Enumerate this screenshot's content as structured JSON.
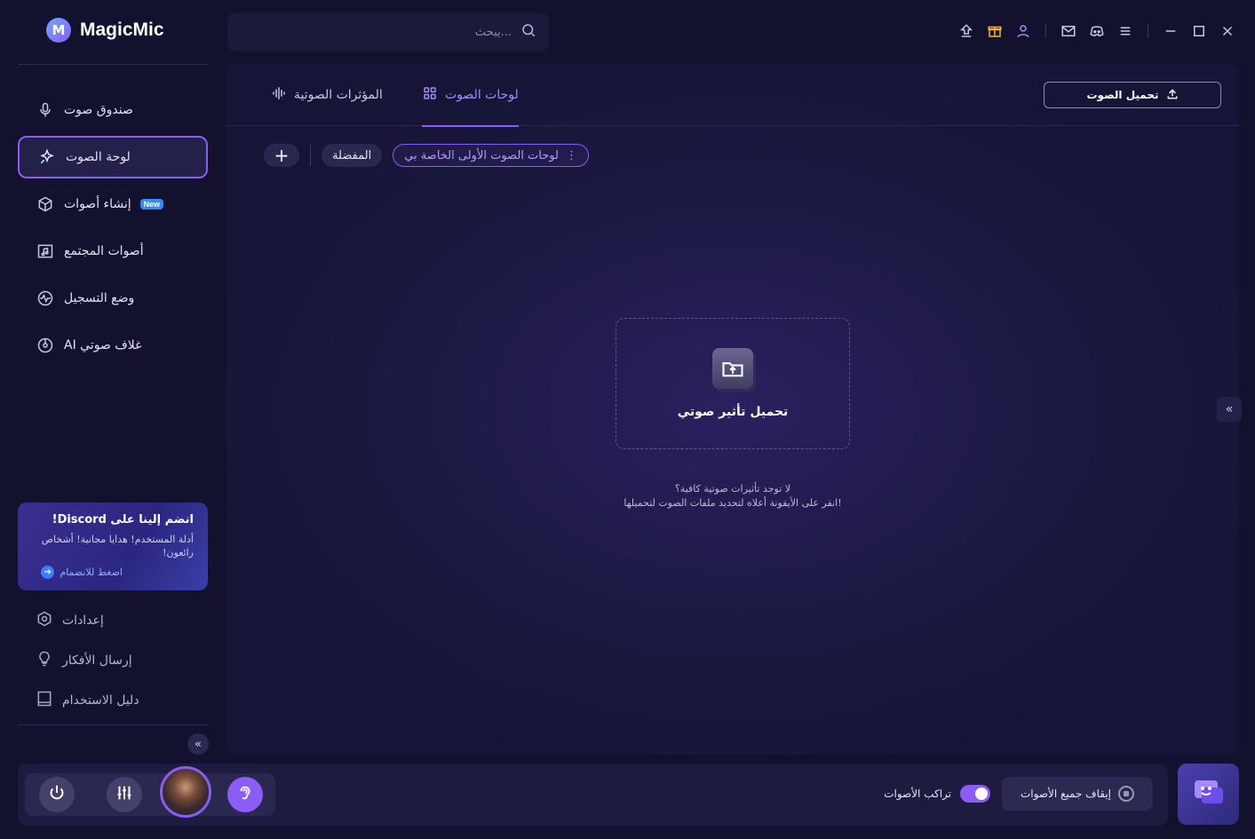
{
  "app": {
    "name": "MagicMic",
    "logo_letter": "M"
  },
  "search": {
    "placeholder": "...يبحث"
  },
  "sidebar": {
    "items": [
      {
        "label": "صندوق صوت",
        "icon": "microphone-icon",
        "active": false
      },
      {
        "label": "لوحة الصوت",
        "icon": "sparkle-board-icon",
        "active": true
      },
      {
        "label": "إنشاء أصوات",
        "icon": "cube-icon",
        "active": false,
        "badge": "New"
      },
      {
        "label": "أصوات المجتمع",
        "icon": "music-folder-icon",
        "active": false
      },
      {
        "label": "وضع التسجيل",
        "icon": "waveform-circle-icon",
        "active": false
      },
      {
        "label": "AI غلاف صوتي",
        "icon": "disc-icon",
        "active": false
      }
    ],
    "promo": {
      "title": "انضم إلينا على Discord!",
      "description": "أدلة المستخدم! هدايا مجانية! أشخاص رائعون!",
      "link": "اضغط للانضمام",
      "link_arrow": "➔"
    },
    "bottom_items": [
      {
        "label": "إعدادات",
        "icon": "settings-hexagon-icon"
      },
      {
        "label": "إرسال الأفكار",
        "icon": "lightbulb-icon"
      },
      {
        "label": "دليل الاستخدام",
        "icon": "book-icon"
      }
    ],
    "collapse_glyph": "«"
  },
  "main": {
    "tabs": [
      {
        "label": "لوحات الصوت",
        "icon": "grid-icon",
        "active": true
      },
      {
        "label": "المؤثرات الصوتية",
        "icon": "waveform-icon",
        "active": false
      }
    ],
    "upload_button": "تحميل الصوت",
    "chips": {
      "add": "+",
      "favorites": "المفضلة",
      "selected_board": "لوحات الصوت الأولى الخاصة بي",
      "menu_glyph": "⋮"
    },
    "dropzone_label": "تحميل تأثير صوتي",
    "hint_line1": "لا توجد تأثيرات صوتية كافية؟",
    "hint_line2": "انقر على الأيقونة أعلاه لتحديد ملفات الصوت لتحميلها!",
    "expand_glyph": "«"
  },
  "bottombar": {
    "overlap_label": "تراكب الأصوات",
    "overlap_enabled": true,
    "stop_all_label": "إيقاف جميع الأصوات"
  },
  "colors": {
    "accent": "#8b5cf6",
    "background": "#13122e",
    "panel": "#1d1a45",
    "link": "#8fb0ff"
  }
}
